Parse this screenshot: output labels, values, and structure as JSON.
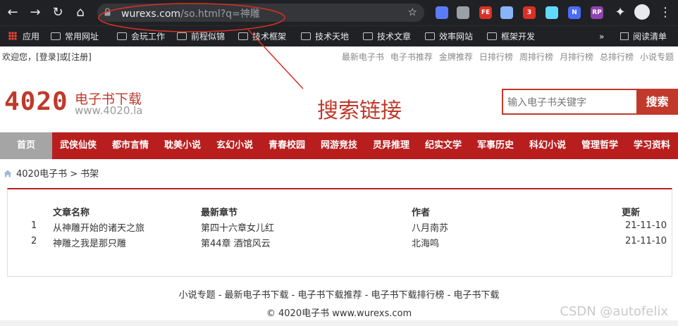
{
  "browser": {
    "url_host": "wurexs.com",
    "url_rest": "/so.html?q=神雕",
    "extensions": [
      {
        "name": "translate-ext",
        "color": "#5b7cfa",
        "label": ""
      },
      {
        "name": "folder-ext",
        "color": "#9aa0a6",
        "label": ""
      },
      {
        "name": "fe-ext",
        "color": "#d93025",
        "label": "FE"
      },
      {
        "name": "ring-ext",
        "color": "#8ab4f8",
        "label": ""
      },
      {
        "name": "badge-ext",
        "color": "#d93025",
        "label": "3"
      },
      {
        "name": "react-ext",
        "color": "#61dafb",
        "label": ""
      },
      {
        "name": "n-ext",
        "color": "#4a6cf7",
        "label": "N"
      },
      {
        "name": "rp-ext",
        "color": "#8e44ad",
        "label": "RP"
      }
    ]
  },
  "bookmarks": {
    "apps": "应用",
    "items": [
      "常用网址",
      "会玩工作",
      "前程似锦",
      "技术框架",
      "技术天地",
      "技术文章",
      "效率网站",
      "框架开发"
    ],
    "more": "»",
    "reading_list": "阅读清单"
  },
  "topbar": {
    "welcome": "欢迎您，",
    "login": "[登录]",
    "or": "或",
    "register": "[注册]",
    "links": [
      "最新电子书",
      "电子书推荐",
      "金牌推荐",
      "日排行榜",
      "周排行榜",
      "月排行榜",
      "总排行榜",
      "小说专题"
    ]
  },
  "logo": {
    "number": "4020",
    "name": "电子书下载",
    "url": "www.4020.la"
  },
  "annotation": "搜索链接",
  "search": {
    "placeholder": "输入电子书关键字",
    "button": "搜索"
  },
  "nav": [
    "首页",
    "武侠仙侠",
    "都市言情",
    "耽美小说",
    "玄幻小说",
    "青春校园",
    "网游竞技",
    "灵异推理",
    "纪实文学",
    "军事历史",
    "科幻小说",
    "管理哲学",
    "学习资料"
  ],
  "breadcrumb": {
    "home": "4020电子书",
    "sep": ">",
    "current": "书架"
  },
  "table": {
    "headers": [
      "文章名称",
      "最新章节",
      "作者",
      "更新"
    ],
    "rows": [
      {
        "num": "1",
        "title": "从神雕开始的诸天之旅",
        "chapter": "第四十六章女儿红",
        "author": "八月南苏",
        "date": "21-11-10"
      },
      {
        "num": "2",
        "title": "神雕之我是那只雕",
        "chapter": "第44章 酒馆风云",
        "author": "北海鸣",
        "date": "21-11-10"
      }
    ]
  },
  "footer": {
    "links": "小说专题 - 最新电子书下载 - 电子书下载推荐 - 电子书下载排行榜 - 电子书下载",
    "copyright": "© 4020电子书 www.wurexs.com"
  },
  "watermark": "CSDN @autofelix",
  "colors": {
    "brand": "#c0392b",
    "nav_bg": "#b81e1e"
  }
}
